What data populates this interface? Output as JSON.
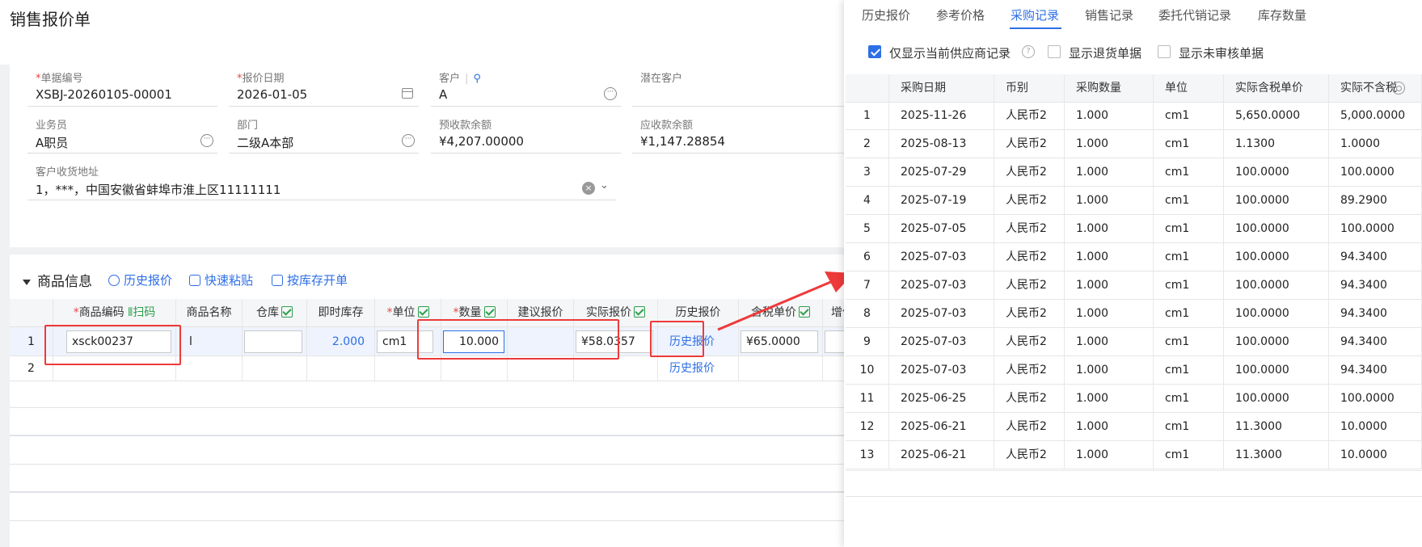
{
  "page": {
    "title": "销售报价单"
  },
  "form": {
    "doc_no": {
      "label": "单据编号",
      "value": "XSBJ-20260105-00001"
    },
    "quote_date": {
      "label": "报价日期",
      "value": "2026-01-05"
    },
    "customer": {
      "label": "客户",
      "value": "A"
    },
    "potential_customer": {
      "label": "潜在客户",
      "value": ""
    },
    "salesperson": {
      "label": "业务员",
      "value": "A职员"
    },
    "department": {
      "label": "部门",
      "value": "二级A本部"
    },
    "advance_balance": {
      "label": "预收款余额",
      "value": "¥4,207.00000"
    },
    "receivable_balance": {
      "label": "应收款余额",
      "value": "¥1,147.28854"
    },
    "address": {
      "label": "客户收货地址",
      "value": "1，***，中国安徽省蚌埠市淮上区11111111"
    }
  },
  "goods": {
    "section_title": "商品信息",
    "tools": [
      "历史报价",
      "快速粘贴",
      "按库存开单"
    ],
    "headers": {
      "code": "商品编码",
      "scan": "扫码",
      "name": "商品名称",
      "warehouse": "仓库",
      "stock": "即时库存",
      "unit": "单位",
      "qty": "数量",
      "suggest": "建议报价",
      "actual": "实际报价",
      "history": "历史报价",
      "tax_price": "含税单价",
      "vat": "增值税"
    },
    "rows": [
      {
        "no": "1",
        "code": "xsck00237",
        "name": "l",
        "stock": "2.000",
        "unit": "cm1",
        "qty": "10.000",
        "actual": "¥58.0357",
        "history": "历史报价",
        "tax_price": "¥65.0000"
      },
      {
        "no": "2",
        "history": "历史报价"
      }
    ]
  },
  "right_panel": {
    "tabs": [
      "历史报价",
      "参考价格",
      "采购记录",
      "销售记录",
      "委托代销记录",
      "库存数量"
    ],
    "active_tab": "采购记录",
    "filters": [
      {
        "label": "仅显示当前供应商记录",
        "checked": true
      },
      {
        "label": "显示退货单据",
        "checked": false
      },
      {
        "label": "显示未审核单据",
        "checked": false
      }
    ],
    "table": {
      "headers": [
        "",
        "采购日期",
        "币别",
        "采购数量",
        "单位",
        "实际含税单价",
        "实际不含税"
      ],
      "rows": [
        [
          "1",
          "2025-11-26",
          "人民币2",
          "1.000",
          "cm1",
          "5,650.0000",
          "5,000.0000"
        ],
        [
          "2",
          "2025-08-13",
          "人民币2",
          "1.000",
          "cm1",
          "1.1300",
          "1.0000"
        ],
        [
          "3",
          "2025-07-29",
          "人民币2",
          "1.000",
          "cm1",
          "100.0000",
          "100.0000"
        ],
        [
          "4",
          "2025-07-19",
          "人民币2",
          "1.000",
          "cm1",
          "100.0000",
          "89.2900"
        ],
        [
          "5",
          "2025-07-05",
          "人民币2",
          "1.000",
          "cm1",
          "100.0000",
          "100.0000"
        ],
        [
          "6",
          "2025-07-03",
          "人民币2",
          "1.000",
          "cm1",
          "100.0000",
          "94.3400"
        ],
        [
          "7",
          "2025-07-03",
          "人民币2",
          "1.000",
          "cm1",
          "100.0000",
          "94.3400"
        ],
        [
          "8",
          "2025-07-03",
          "人民币2",
          "1.000",
          "cm1",
          "100.0000",
          "94.3400"
        ],
        [
          "9",
          "2025-07-03",
          "人民币2",
          "1.000",
          "cm1",
          "100.0000",
          "94.3400"
        ],
        [
          "10",
          "2025-07-03",
          "人民币2",
          "1.000",
          "cm1",
          "100.0000",
          "94.3400"
        ],
        [
          "11",
          "2025-06-25",
          "人民币2",
          "1.000",
          "cm1",
          "100.0000",
          "100.0000"
        ],
        [
          "12",
          "2025-06-21",
          "人民币2",
          "1.000",
          "cm1",
          "11.3000",
          "10.0000"
        ],
        [
          "13",
          "2025-06-21",
          "人民币2",
          "1.000",
          "cm1",
          "11.3000",
          "10.0000"
        ]
      ]
    }
  },
  "colors": {
    "accent": "#2e6fe6",
    "annotation": "#ee3a3a",
    "check": "#2aa04a"
  }
}
